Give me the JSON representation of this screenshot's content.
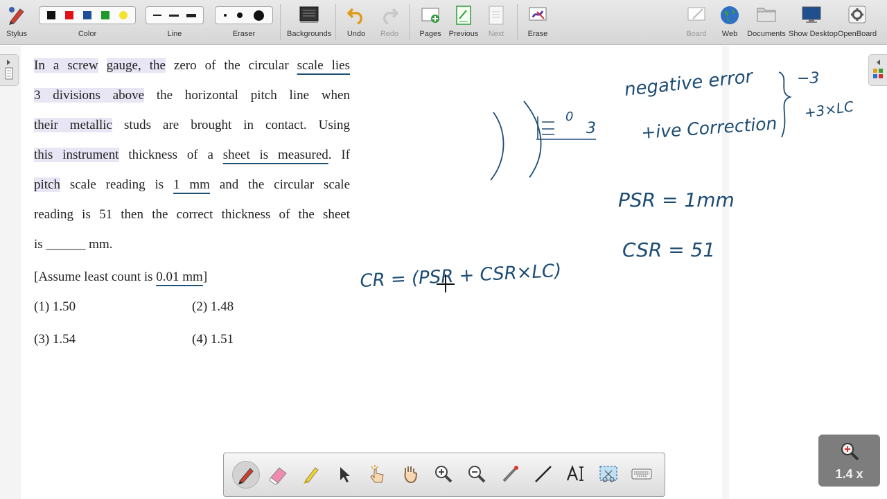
{
  "toolbar": {
    "stylus": "Stylus",
    "color": "Color",
    "line": "Line",
    "eraser": "Eraser",
    "backgrounds": "Backgrounds",
    "undo": "Undo",
    "redo": "Redo",
    "pages": "Pages",
    "previous": "Previous",
    "next": "Next",
    "erase": "Erase",
    "board": "Board",
    "web": "Web",
    "documents": "Documents",
    "show_desktop": "Show Desktop",
    "openboard": "OpenBoard",
    "colors": [
      "#111111",
      "#e0101a",
      "#1d4f9a",
      "#1f9a2a",
      "#f2e332"
    ]
  },
  "question": {
    "l1_a": "In a screw",
    "l1_b": "gauge, the",
    "l1_c": "zero of the circular",
    "l1_d": "scale lies",
    "l2_a": "3 divisions above",
    "l2_b": "the horizontal pitch line when",
    "l3_a": "their metallic",
    "l3_b": "studs are brought in contact. Using",
    "l4_a": "this instrument",
    "l4_b": "thickness of a",
    "l4_c": "sheet is measured",
    "l4_d": ". If",
    "l5_a": "pitch",
    "l5_b": "scale reading is",
    "l5_c": "1 mm",
    "l5_d": "and the circular scale",
    "l6": "reading is 51 then the correct thickness of the sheet",
    "l7": "is ______ mm.",
    "l8_a": "[Assume least count is",
    "l8_b": "0.01 mm",
    "l8_c": "]",
    "opt1": "(1) 1.50",
    "opt2": "(2) 1.48",
    "opt3": "(3) 1.54",
    "opt4": "(4) 1.51"
  },
  "annotations": {
    "neg_error": "negative error",
    "minus3": "−3",
    "pos_correction": "+ive Correction",
    "plus3lc": "+3×LC",
    "psr": "PSR = 1mm",
    "csr": "CSR = 51",
    "cr": "CR = (PSR + CSR×LC)",
    "scale_zero": "0",
    "scale_three": "3"
  },
  "zoom": {
    "label": "1.4 x"
  }
}
